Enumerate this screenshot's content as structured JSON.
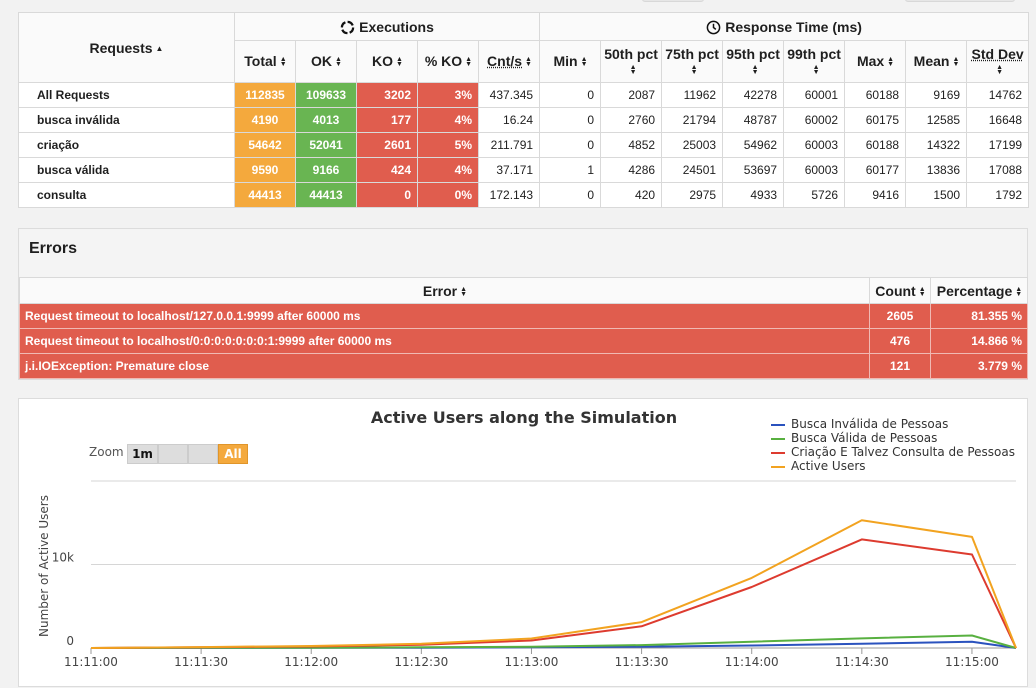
{
  "stats": {
    "requests_header": "Requests",
    "executions_header": "Executions",
    "response_time_header": "Response Time (ms)",
    "columns": [
      "Total",
      "OK",
      "KO",
      "% KO",
      "Cnt/s",
      "Min",
      "50th pct",
      "75th pct",
      "95th pct",
      "99th pct",
      "Max",
      "Mean",
      "Std Dev"
    ],
    "rows": [
      {
        "name": "All Requests",
        "values": [
          "112835",
          "109633",
          "3202",
          "3%",
          "437.345",
          "0",
          "2087",
          "11962",
          "42278",
          "60001",
          "60188",
          "9169",
          "14762"
        ]
      },
      {
        "name": "busca inválida",
        "values": [
          "4190",
          "4013",
          "177",
          "4%",
          "16.24",
          "0",
          "2760",
          "21794",
          "48787",
          "60002",
          "60175",
          "12585",
          "16648"
        ]
      },
      {
        "name": "criação",
        "values": [
          "54642",
          "52041",
          "2601",
          "5%",
          "211.791",
          "0",
          "4852",
          "25003",
          "54962",
          "60003",
          "60188",
          "14322",
          "17199"
        ]
      },
      {
        "name": "busca válida",
        "values": [
          "9590",
          "9166",
          "424",
          "4%",
          "37.171",
          "1",
          "4286",
          "24501",
          "53697",
          "60003",
          "60177",
          "13836",
          "17088"
        ]
      },
      {
        "name": "consulta",
        "values": [
          "44413",
          "44413",
          "0",
          "0%",
          "172.143",
          "0",
          "420",
          "2975",
          "4933",
          "5726",
          "9416",
          "1500",
          "1792"
        ]
      }
    ]
  },
  "errors": {
    "title": "Errors",
    "columns": [
      "Error",
      "Count",
      "Percentage"
    ],
    "rows": [
      {
        "error": "Request timeout to localhost/127.0.0.1:9999 after 60000 ms",
        "count": "2605",
        "pct": "81.355 %"
      },
      {
        "error": "Request timeout to localhost/0:0:0:0:0:0:0:1:9999 after 60000 ms",
        "count": "476",
        "pct": "14.866 %"
      },
      {
        "error": "j.i.IOException: Premature close",
        "count": "121",
        "pct": "3.779 %"
      }
    ]
  },
  "chart_data": {
    "type": "line",
    "title": "Active Users along the Simulation",
    "ylabel": "Number of Active Users",
    "xlabel": "",
    "zoom_label": "Zoom",
    "zoom_buttons": [
      "1m",
      "",
      "",
      "All"
    ],
    "zoom_active": "All",
    "y_ticks": [
      {
        "value": 0,
        "label": "0"
      },
      {
        "value": 10000,
        "label": "10k"
      }
    ],
    "ylim": [
      0,
      20000
    ],
    "x_ticks": [
      "11:11:00",
      "11:11:30",
      "11:12:00",
      "11:12:30",
      "11:13:00",
      "11:13:30",
      "11:14:00",
      "11:14:30",
      "11:15:00"
    ],
    "x_seconds": [
      0,
      30,
      60,
      90,
      120,
      150,
      180,
      210,
      240,
      252
    ],
    "xlim_seconds": [
      0,
      252
    ],
    "legend_position": "top-right",
    "series": [
      {
        "name": "Busca Inválida de Pessoas",
        "color": "#2a52be",
        "values": [
          0,
          10,
          20,
          40,
          80,
          150,
          300,
          500,
          750,
          0
        ]
      },
      {
        "name": "Busca Válida de Pessoas",
        "color": "#58b040",
        "values": [
          0,
          20,
          40,
          80,
          160,
          350,
          750,
          1150,
          1500,
          0
        ]
      },
      {
        "name": "Criação E Talvez Consulta de Pessoas",
        "color": "#dd3b2f",
        "values": [
          0,
          80,
          180,
          380,
          900,
          2600,
          7300,
          13000,
          11200,
          0
        ]
      },
      {
        "name": "Active Users",
        "color": "#f2a320",
        "values": [
          0,
          110,
          240,
          500,
          1140,
          3100,
          8400,
          15300,
          13300,
          0
        ]
      }
    ]
  }
}
